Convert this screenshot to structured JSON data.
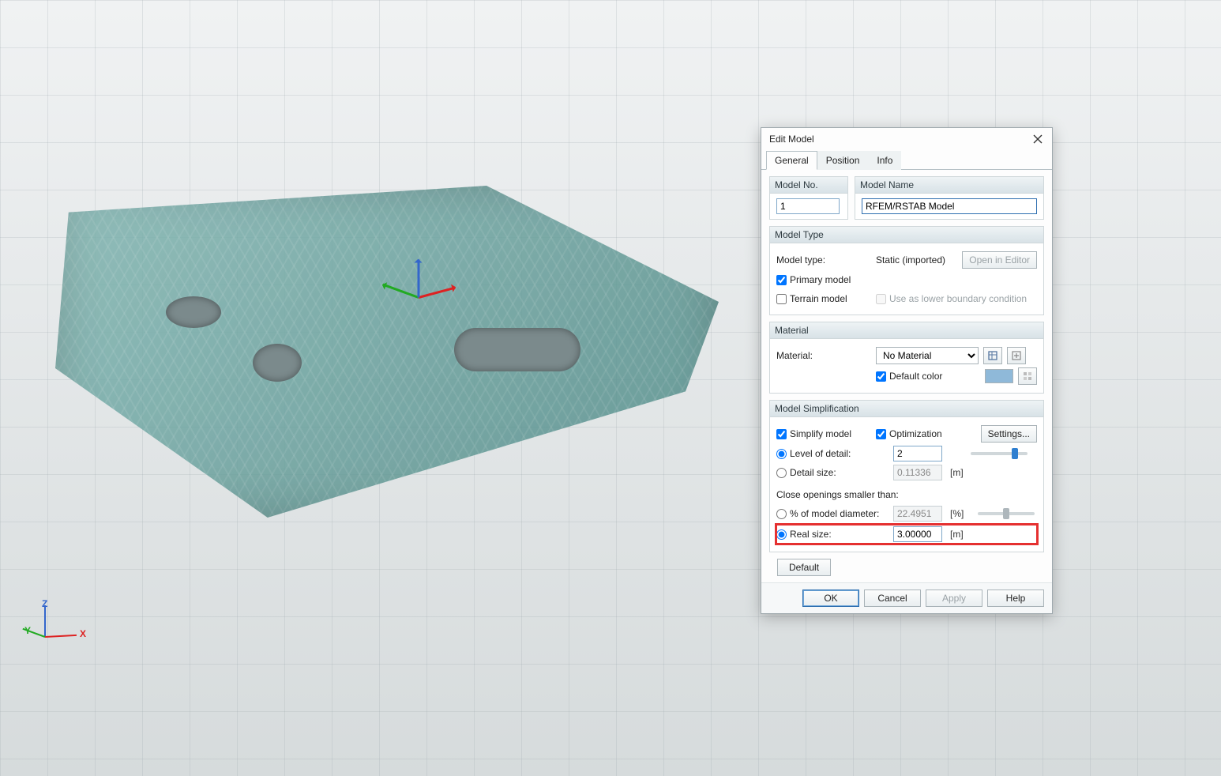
{
  "viewport": {
    "axes": {
      "x": "X",
      "y": "Y",
      "z": "Z"
    }
  },
  "dialog": {
    "title": "Edit Model",
    "tabs": {
      "general": "General",
      "position": "Position",
      "info": "Info"
    },
    "model_no_group": "Model No.",
    "model_name_group": "Model Name",
    "model_no_value": "1",
    "model_name_value": "RFEM/RSTAB Model",
    "model_type_group": "Model Type",
    "model_type_label": "Model type:",
    "model_type_value": "Static (imported)",
    "open_in_editor": "Open in Editor",
    "primary_model": "Primary model",
    "terrain_model": "Terrain model",
    "use_lower_bc": "Use as lower boundary condition",
    "material_group": "Material",
    "material_label": "Material:",
    "material_value": "No Material",
    "default_color": "Default color",
    "simplification_group": "Model Simplification",
    "simplify_model": "Simplify model",
    "optimization": "Optimization",
    "settings_btn": "Settings...",
    "lod_label": "Level of detail:",
    "lod_value": "2",
    "detail_size_label": "Detail size:",
    "detail_size_value": "0.11336",
    "detail_size_unit": "[m]",
    "close_openings_label": "Close openings smaller than:",
    "pct_diameter_label": "% of model diameter:",
    "pct_diameter_value": "22.4951",
    "pct_unit": "[%]",
    "real_size_label": "Real size:",
    "real_size_value": "3.00000",
    "real_size_unit": "[m]",
    "default_btn": "Default",
    "ok": "OK",
    "cancel": "Cancel",
    "apply": "Apply",
    "help": "Help"
  }
}
